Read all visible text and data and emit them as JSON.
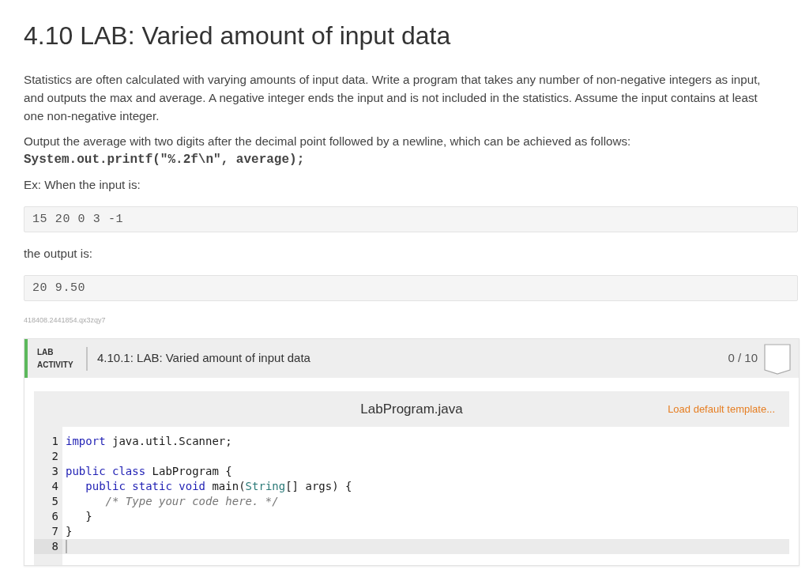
{
  "title": "4.10 LAB: Varied amount of input data",
  "instructions": {
    "intro": "Statistics are often calculated with varying amounts of input data. Write a program that takes any number of non-negative integers as input, and outputs the max and average. A negative integer ends the input and is not included in the statistics. Assume the input contains at least one non-negative integer.",
    "format_note": "Output the average with two digits after the decimal point followed by a newline, which can be achieved as follows:",
    "format_code": "System.out.printf(\"%.2f\\n\", average);"
  },
  "example": {
    "input_label": "Ex: When the input is:",
    "input": "15 20 0 3 -1",
    "output_label": "the output is:",
    "output": "20 9.50"
  },
  "problem_id": "418408.2441854.qx3zqy7",
  "lab_activity": {
    "label": "LAB ACTIVITY",
    "title": "4.10.1: LAB: Varied amount of input data",
    "score": "0 / 10"
  },
  "editor": {
    "filename": "LabProgram.java",
    "load_template_link": "Load default template...",
    "lines": [
      {
        "number": "1",
        "active": false,
        "tokens": [
          {
            "kind": "keyword",
            "text": "import"
          },
          {
            "kind": "plain",
            "text": " java.util.Scanner;"
          }
        ]
      },
      {
        "number": "2",
        "active": false
      },
      {
        "number": "3",
        "active": false,
        "tokens": [
          {
            "kind": "keyword",
            "text": "public class"
          },
          {
            "kind": "plain",
            "text": " LabProgram {"
          }
        ]
      },
      {
        "number": "4",
        "active": false,
        "tokens": [
          {
            "kind": "keyword",
            "text": "   public static void"
          },
          {
            "kind": "plain",
            "text": " main("
          },
          {
            "kind": "type",
            "text": "String"
          },
          {
            "kind": "plain",
            "text": "[] args) {"
          }
        ]
      },
      {
        "number": "5",
        "active": false,
        "tokens": [
          {
            "kind": "comment",
            "text": "      /* Type your code here. */"
          }
        ]
      },
      {
        "number": "6",
        "active": false,
        "tokens": [
          {
            "kind": "plain",
            "text": "   }"
          }
        ]
      },
      {
        "number": "7",
        "active": false,
        "tokens": [
          {
            "kind": "plain",
            "text": "}"
          }
        ]
      },
      {
        "number": "8",
        "active": true
      }
    ]
  }
}
